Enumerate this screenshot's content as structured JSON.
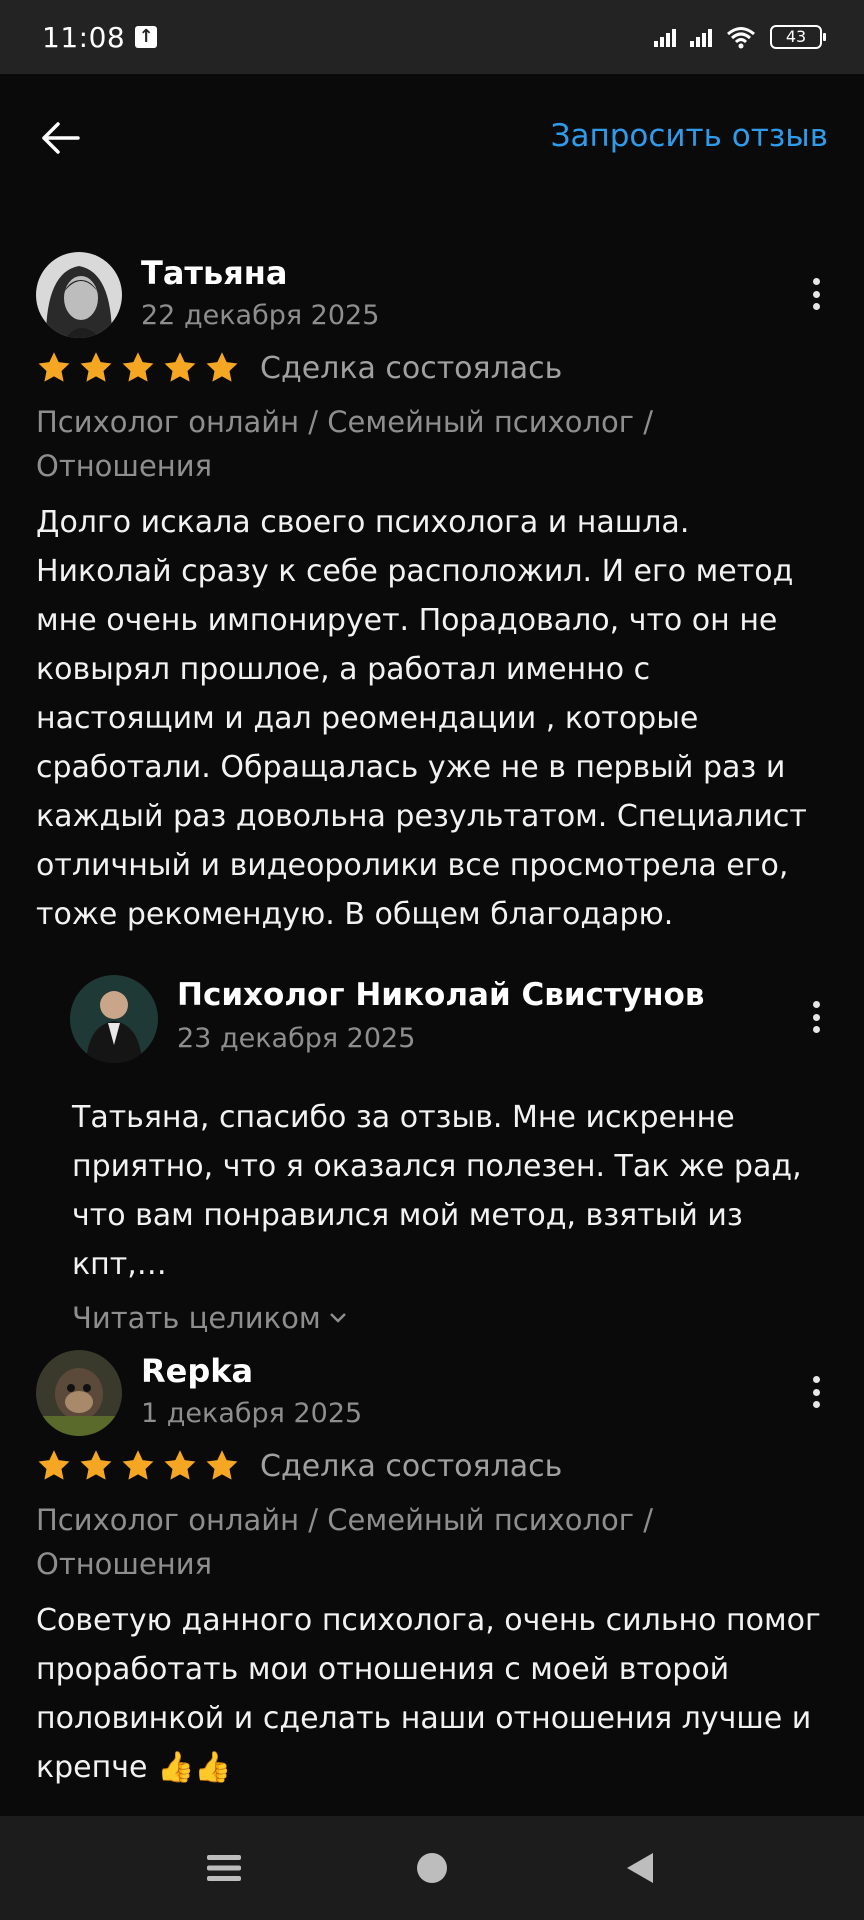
{
  "status_bar": {
    "time": "11:08",
    "battery": "43"
  },
  "header": {
    "request_review_label": "Запросить отзыв"
  },
  "reviews": [
    {
      "author": "Татьяна",
      "date": "22 декабря 2025",
      "rating": 5,
      "deal_status": "Сделка состоялась",
      "category": "Психолог онлайн / Семейный психолог / Отношения",
      "text": "Долго искала своего психолога и нашла. Николай сразу к себе расположил. И его метод мне очень импонирует. Порадовало, что он не ковырял прошлое, а работал именно с настоящим и дал реомендации , которые сработали. Обращалась уже не в первый раз и каждый раз довольна результатом. Специалист отличный и видеоролики все просмотрела его, тоже рекомендую. В общем благодарю.",
      "reply": {
        "author": "Психолог Николай Свистунов",
        "date": "23 декабря 2025",
        "text": "Татьяна, спасибо за отзыв. Мне искренне приятно, что я оказался полезен. Так же  рад, что вам  понравился мой метод, взятый из кпт,…",
        "read_more_label": "Читать целиком"
      }
    },
    {
      "author": "Repka",
      "date": "1 декабря 2025",
      "rating": 5,
      "deal_status": "Сделка состоялась",
      "category": "Психолог онлайн / Семейный психолог / Отношения",
      "text": "Советую данного психолога, очень сильно помог проработать мои отношения с моей второй половинкой и сделать наши отношения лучше и крепче 👍👍"
    }
  ],
  "colors": {
    "accent": "#2f9bea",
    "star": "#f5a623",
    "background": "#0a0a0a"
  },
  "icons": [
    "back-arrow-icon",
    "more-vert-icon",
    "star-icon",
    "chevron-down-icon",
    "nav-menu-icon",
    "nav-home-icon",
    "nav-back-icon"
  ]
}
